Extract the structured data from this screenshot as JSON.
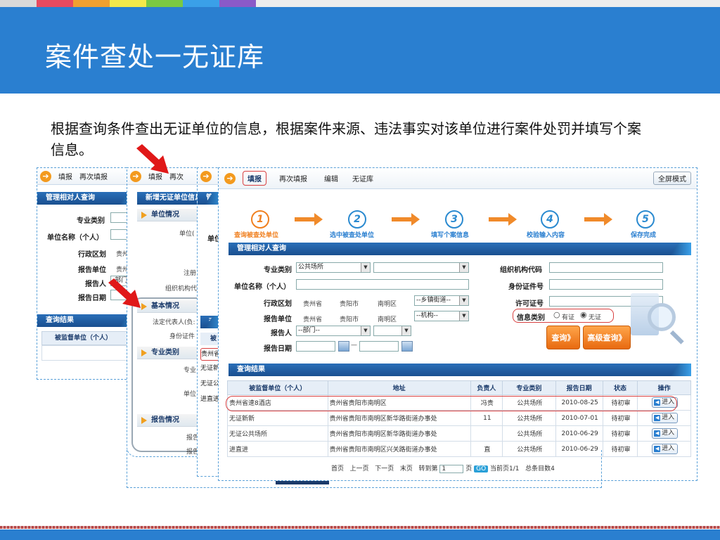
{
  "slide": {
    "title": "案件查处一无证库",
    "description": "根据查询条件查出无证单位的信息，根据案件来源、违法事实对该单位进行案件处罚并填写个案信息。",
    "strip_colors": [
      "#d9d9d9",
      "#e84a5f",
      "#f0a030",
      "#f4e94a",
      "#7ac943",
      "#3aa0e8",
      "#8a5ac8",
      "#ededed"
    ]
  },
  "win1": {
    "toolbar": [
      "填报",
      "再次填报"
    ],
    "section": "管理相对人查询",
    "fields": [
      "专业类别",
      "单位名称（个人）",
      "行政区划",
      "报告单位",
      "报告人",
      "报告日期"
    ],
    "values": {
      "region": "贵州",
      "report_unit": "贵州",
      "reporter": "-部门"
    },
    "result_section": "查询结果",
    "result_header": "被监督单位（个人）"
  },
  "win2": {
    "toolbar": [
      "填报",
      "再次"
    ],
    "section": "新增无证单位信息",
    "groups": {
      "unit": "单位情况",
      "basic": "基本情况",
      "specialty": "专业类别",
      "report": "报告情况"
    },
    "labels": {
      "unit_field": "单位(",
      "registered": "注册",
      "org_code": "组织机构代",
      "legal_rep": "法定代表人(负:",
      "id_card": "身份证件",
      "specialty_field": "专业",
      "unit_field2": "单位",
      "reporter1": "报告人1：",
      "reporter2": "报告人2："
    }
  },
  "win3": {
    "section_abbr": "管",
    "unit_abbr": "单位",
    "result_abbr": "查",
    "header_abbr": "被",
    "rows": [
      "贵州省",
      "无证新",
      "无证公",
      "进直进"
    ]
  },
  "main": {
    "toolbar": {
      "fill": "填报",
      "refill": "再次填报",
      "edit": "编辑",
      "nocert": "无证库",
      "fullscreen": "全屏模式"
    },
    "steps": [
      {
        "num": "1",
        "label": "查询被查处单位"
      },
      {
        "num": "2",
        "label": "选中被查处单位"
      },
      {
        "num": "3",
        "label": "填写个案信息"
      },
      {
        "num": "4",
        "label": "校验输入内容"
      },
      {
        "num": "5",
        "label": "保存完成"
      }
    ],
    "query_section": "管理相对人查询",
    "form": {
      "specialty_label": "专业类别",
      "specialty_value": "公共场所",
      "unit_name_label": "单位名称（个人）",
      "region_label": "行政区划",
      "region_values": [
        "贵州省",
        "贵阳市",
        "南明区"
      ],
      "region_select": "--乡镇街道--",
      "report_unit_label": "报告单位",
      "report_unit_values": [
        "贵州省",
        "贵阳市",
        "南明区"
      ],
      "report_unit_select": "--机构--",
      "reporter_label": "报告人",
      "reporter_value": "--部门--",
      "report_date_label": "报告日期",
      "date_sep": "—",
      "org_code_label": "组织机构代码",
      "id_card_label": "身份证件号",
      "license_label": "许可证号",
      "info_type_label": "信息类别",
      "opt_cert": "有证",
      "opt_nocert": "无证",
      "selected_info_type": "无证"
    },
    "buttons": {
      "query": "查询》",
      "advanced_query": "高级查询》"
    },
    "result_section": "查询结果",
    "table": {
      "headers": [
        "被监督单位（个人）",
        "地址",
        "负责人",
        "专业类别",
        "报告日期",
        "状态",
        "操作"
      ],
      "rows": [
        [
          "贵州省速8酒店",
          "贵州省贵阳市南明区",
          "冯贵",
          "公共场所",
          "2010-08-25",
          "待初审",
          "进入"
        ],
        [
          "无证新新",
          "贵州省贵阳市南明区新华路街道办事处",
          "11",
          "公共场所",
          "2010-07-01",
          "待初审",
          "进入"
        ],
        [
          "无证公共场所",
          "贵州省贵阳市南明区新华路街道办事处",
          "",
          "公共场所",
          "2010-06-29",
          "待初审",
          "进入"
        ],
        [
          "进直进",
          "贵州省贵阳市南明区兴关路街道办事处",
          "直",
          "公共场所",
          "2010-06-29",
          "待初审",
          "进入"
        ]
      ]
    },
    "pager": {
      "first": "首页",
      "prev": "上一页",
      "next": "下一页",
      "last": "末页",
      "goto": "转到第",
      "page_input": "1",
      "page_unit": "页",
      "go": "GO",
      "current": "当前页1/1",
      "total": "总条目数4"
    }
  }
}
